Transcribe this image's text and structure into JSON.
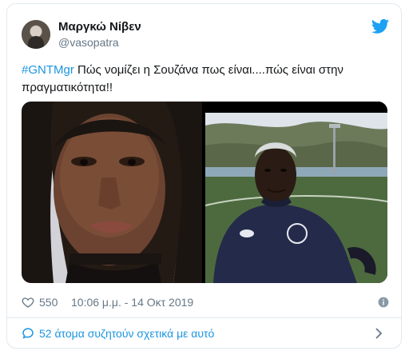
{
  "tweet": {
    "author_name": "Μαργκώ Νίβεν",
    "author_handle": "@vasopatra",
    "hashtag": "#GNTMgr",
    "text": " Πώς νομίζει η Σουζάνα πως είναι....πώς είναι στην πραγματικότητα!!",
    "likes": "550",
    "timestamp": "10:06 μ.μ. - 14 Οκτ 2019",
    "discussion_label": "52 άτομα συζητούν σχετικά με αυτό"
  },
  "colors": {
    "brand_blue": "#1b95e0",
    "muted_text": "#657786",
    "border": "#e1e8ed"
  },
  "icons": {
    "logo": "twitter-bird-icon",
    "like": "heart-icon",
    "info": "info-icon",
    "replies": "speech-bubble-icon",
    "more": "chevron-right-icon"
  }
}
